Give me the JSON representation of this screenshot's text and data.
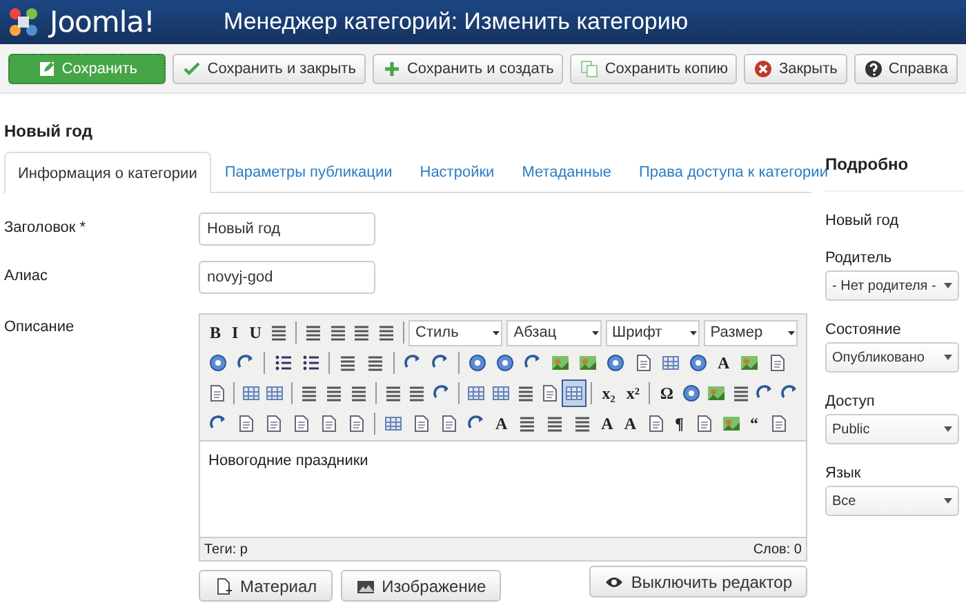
{
  "header": {
    "logo": "Joomla!",
    "title": "Менеджер категорий: Изменить категорию"
  },
  "actions": [
    {
      "label": "Сохранить",
      "kind": "primary"
    },
    {
      "label": "Сохранить и закрыть",
      "kind": "default"
    },
    {
      "label": "Сохранить и создать",
      "kind": "default"
    },
    {
      "label": "Сохранить копию",
      "kind": "default"
    },
    {
      "label": "Закрыть",
      "kind": "default"
    },
    {
      "label": "Справка",
      "kind": "default"
    }
  ],
  "heading": "Новый год",
  "tabs": [
    {
      "label": "Информация о категории",
      "selected": true
    },
    {
      "label": "Параметры публикации",
      "selected": false
    },
    {
      "label": "Настройки",
      "selected": false
    },
    {
      "label": "Метаданные",
      "selected": false
    },
    {
      "label": "Права доступа к категории",
      "selected": false
    }
  ],
  "fields": [
    {
      "label": "Заголовок *",
      "value": "Новый год"
    },
    {
      "label": "Алиас",
      "value": "novyj-god"
    }
  ],
  "editor": {
    "label": "Описание",
    "toolbar": [
      [
        {
          "kind": "glyph",
          "text": "B"
        },
        {
          "kind": "glyph",
          "text": "I"
        },
        {
          "kind": "glyph",
          "text": "U"
        },
        {
          "kind": "lines"
        },
        {
          "kind": "sep"
        },
        {
          "kind": "lines"
        },
        {
          "kind": "lines"
        },
        {
          "kind": "lines"
        },
        {
          "kind": "lines"
        },
        {
          "kind": "sep"
        },
        {
          "kind": "select",
          "text": "Стиль"
        },
        {
          "kind": "select",
          "text": "Абзац"
        },
        {
          "kind": "select",
          "text": "Шрифт"
        },
        {
          "kind": "select",
          "text": "Размер"
        }
      ],
      [
        {
          "kind": "circle"
        },
        {
          "kind": "arrow"
        },
        {
          "kind": "sep"
        },
        {
          "kind": "list"
        },
        {
          "kind": "list"
        },
        {
          "kind": "sep"
        },
        {
          "kind": "lines"
        },
        {
          "kind": "lines"
        },
        {
          "kind": "sep"
        },
        {
          "kind": "arrow"
        },
        {
          "kind": "arrow"
        },
        {
          "kind": "sep"
        },
        {
          "kind": "circle"
        },
        {
          "kind": "circle"
        },
        {
          "kind": "arrow"
        },
        {
          "kind": "image"
        },
        {
          "kind": "image"
        },
        {
          "kind": "circle"
        },
        {
          "kind": "page"
        },
        {
          "kind": "grid"
        },
        {
          "kind": "circle"
        },
        {
          "kind": "glyph",
          "text": "A"
        },
        {
          "kind": "image"
        },
        {
          "kind": "page"
        }
      ],
      [
        {
          "kind": "page"
        },
        {
          "kind": "sep"
        },
        {
          "kind": "grid"
        },
        {
          "kind": "grid"
        },
        {
          "kind": "sep"
        },
        {
          "kind": "lines"
        },
        {
          "kind": "lines"
        },
        {
          "kind": "lines"
        },
        {
          "kind": "sep"
        },
        {
          "kind": "lines"
        },
        {
          "kind": "lines"
        },
        {
          "kind": "arrow"
        },
        {
          "kind": "sep"
        },
        {
          "kind": "grid"
        },
        {
          "kind": "grid"
        },
        {
          "kind": "lines"
        },
        {
          "kind": "page"
        },
        {
          "kind": "grid",
          "selected": true
        },
        {
          "kind": "sep"
        },
        {
          "kind": "glyph",
          "text": "x₂"
        },
        {
          "kind": "glyph",
          "text": "x²"
        },
        {
          "kind": "sep"
        },
        {
          "kind": "glyph",
          "text": "Ω"
        },
        {
          "kind": "circle"
        },
        {
          "kind": "image"
        },
        {
          "kind": "lines"
        },
        {
          "kind": "arrow"
        },
        {
          "kind": "arrow"
        }
      ],
      [
        {
          "kind": "arrow"
        },
        {
          "kind": "page"
        },
        {
          "kind": "page"
        },
        {
          "kind": "page"
        },
        {
          "kind": "page"
        },
        {
          "kind": "page"
        },
        {
          "kind": "sep"
        },
        {
          "kind": "grid"
        },
        {
          "kind": "page"
        },
        {
          "kind": "page"
        },
        {
          "kind": "arrow"
        },
        {
          "kind": "glyph",
          "text": "A"
        },
        {
          "kind": "lines"
        },
        {
          "kind": "lines"
        },
        {
          "kind": "lines"
        },
        {
          "kind": "glyph",
          "text": "A"
        },
        {
          "kind": "glyph",
          "text": "A"
        },
        {
          "kind": "page"
        },
        {
          "kind": "glyph",
          "text": "¶"
        },
        {
          "kind": "page"
        },
        {
          "kind": "image"
        },
        {
          "kind": "glyph",
          "text": "“"
        },
        {
          "kind": "page"
        }
      ]
    ],
    "content": "Новогодние праздники",
    "path": "Теги: p",
    "wordcount": "Слов: 0",
    "buttons": [
      "Материал",
      "Изображение"
    ],
    "toggle": "Выключить редактор"
  },
  "sidebar": {
    "title": "Подробно",
    "name": "Новый год",
    "selects": [
      {
        "label": "Родитель",
        "value": "- Нет родителя -"
      },
      {
        "label": "Состояние",
        "value": "Опубликовано"
      },
      {
        "label": "Доступ",
        "value": "Public"
      },
      {
        "label": "Язык",
        "value": "Все"
      }
    ]
  }
}
